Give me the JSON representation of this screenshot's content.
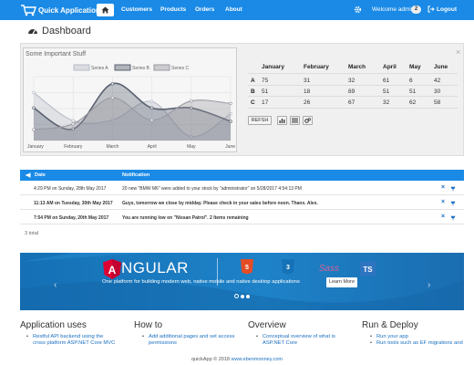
{
  "navbar": {
    "brand": "Quick Application",
    "items": [
      "Customers",
      "Products",
      "Orders",
      "About"
    ],
    "welcome": "Welcome admin",
    "badge": "2",
    "logout": "Logout",
    "color": "#1a8ae6"
  },
  "page": {
    "title": "Dashboard"
  },
  "chart_data": {
    "type": "area",
    "title": "Some Important Stuff",
    "categories": [
      "January",
      "February",
      "March",
      "April",
      "May",
      "June"
    ],
    "series": [
      {
        "name": "Series A",
        "values": [
          75,
          31,
          32,
          61,
          6,
          42
        ],
        "color": "#b8bcc8"
      },
      {
        "name": "Series B",
        "values": [
          51,
          18,
          89,
          51,
          51,
          30
        ],
        "color": "#5a6170"
      },
      {
        "name": "Series C",
        "values": [
          17,
          26,
          67,
          32,
          62,
          58
        ],
        "color": "#9a9aa2"
      }
    ],
    "ylim": [
      0,
      100
    ],
    "legend": "top"
  },
  "table": {
    "headers": [
      "January",
      "February",
      "March",
      "April",
      "May",
      "June"
    ],
    "rows": [
      {
        "label": "A",
        "values": [
          "75",
          "31",
          "32",
          "61",
          "6",
          "42"
        ]
      },
      {
        "label": "B",
        "values": [
          "51",
          "18",
          "89",
          "51",
          "51",
          "30"
        ]
      },
      {
        "label": "C",
        "values": [
          "17",
          "26",
          "67",
          "32",
          "62",
          "58"
        ]
      }
    ],
    "refresh_label": "REFSH"
  },
  "notifications": {
    "headers": {
      "date": "Date",
      "notification": "Notification"
    },
    "rows": [
      {
        "date": "4:29 PM on Sunday, 28th May 2017",
        "message": "20 new \"BMW M6\" were added to your stock by \"administrator\" on 5/28/2017 4:54:13 PM",
        "bold": false
      },
      {
        "date": "11:13 AM on Tuesday, 30th May 2017",
        "message": "Guys, tomorrow we close by midday. Please check in your sales before noon. Thanx. Alex.",
        "bold": true
      },
      {
        "date": "7:54 PM on Sunday, 20th May 2017",
        "message": "You are running low on \"Nissan Patrol\". 2 Items remaining",
        "bold": true
      }
    ],
    "total": "3 total"
  },
  "banner": {
    "brand": "NGULAR",
    "brand_initial": "A",
    "tagline": "One platform for building modern web, native mobile and native desktop applications",
    "button": "Learn More",
    "html_label": "5",
    "css_label": "3",
    "sass_label": "Sass",
    "ts_label": "TS"
  },
  "columns": [
    {
      "title": "Application uses",
      "items": [
        "Restful API backend using the cross platform ASP.NET Core MVC"
      ]
    },
    {
      "title": "How to",
      "items": [
        "Add additional pages and set access permissions"
      ]
    },
    {
      "title": "Overview",
      "items": [
        "Conceptual overview of what is ASP.NET Core"
      ]
    },
    {
      "title": "Run & Deploy",
      "items": [
        "Run your app",
        "Run tools such as EF migrations and"
      ]
    }
  ],
  "footer": {
    "text": "quickApp © 2018 ",
    "link": "www.ebenmonney.com"
  }
}
